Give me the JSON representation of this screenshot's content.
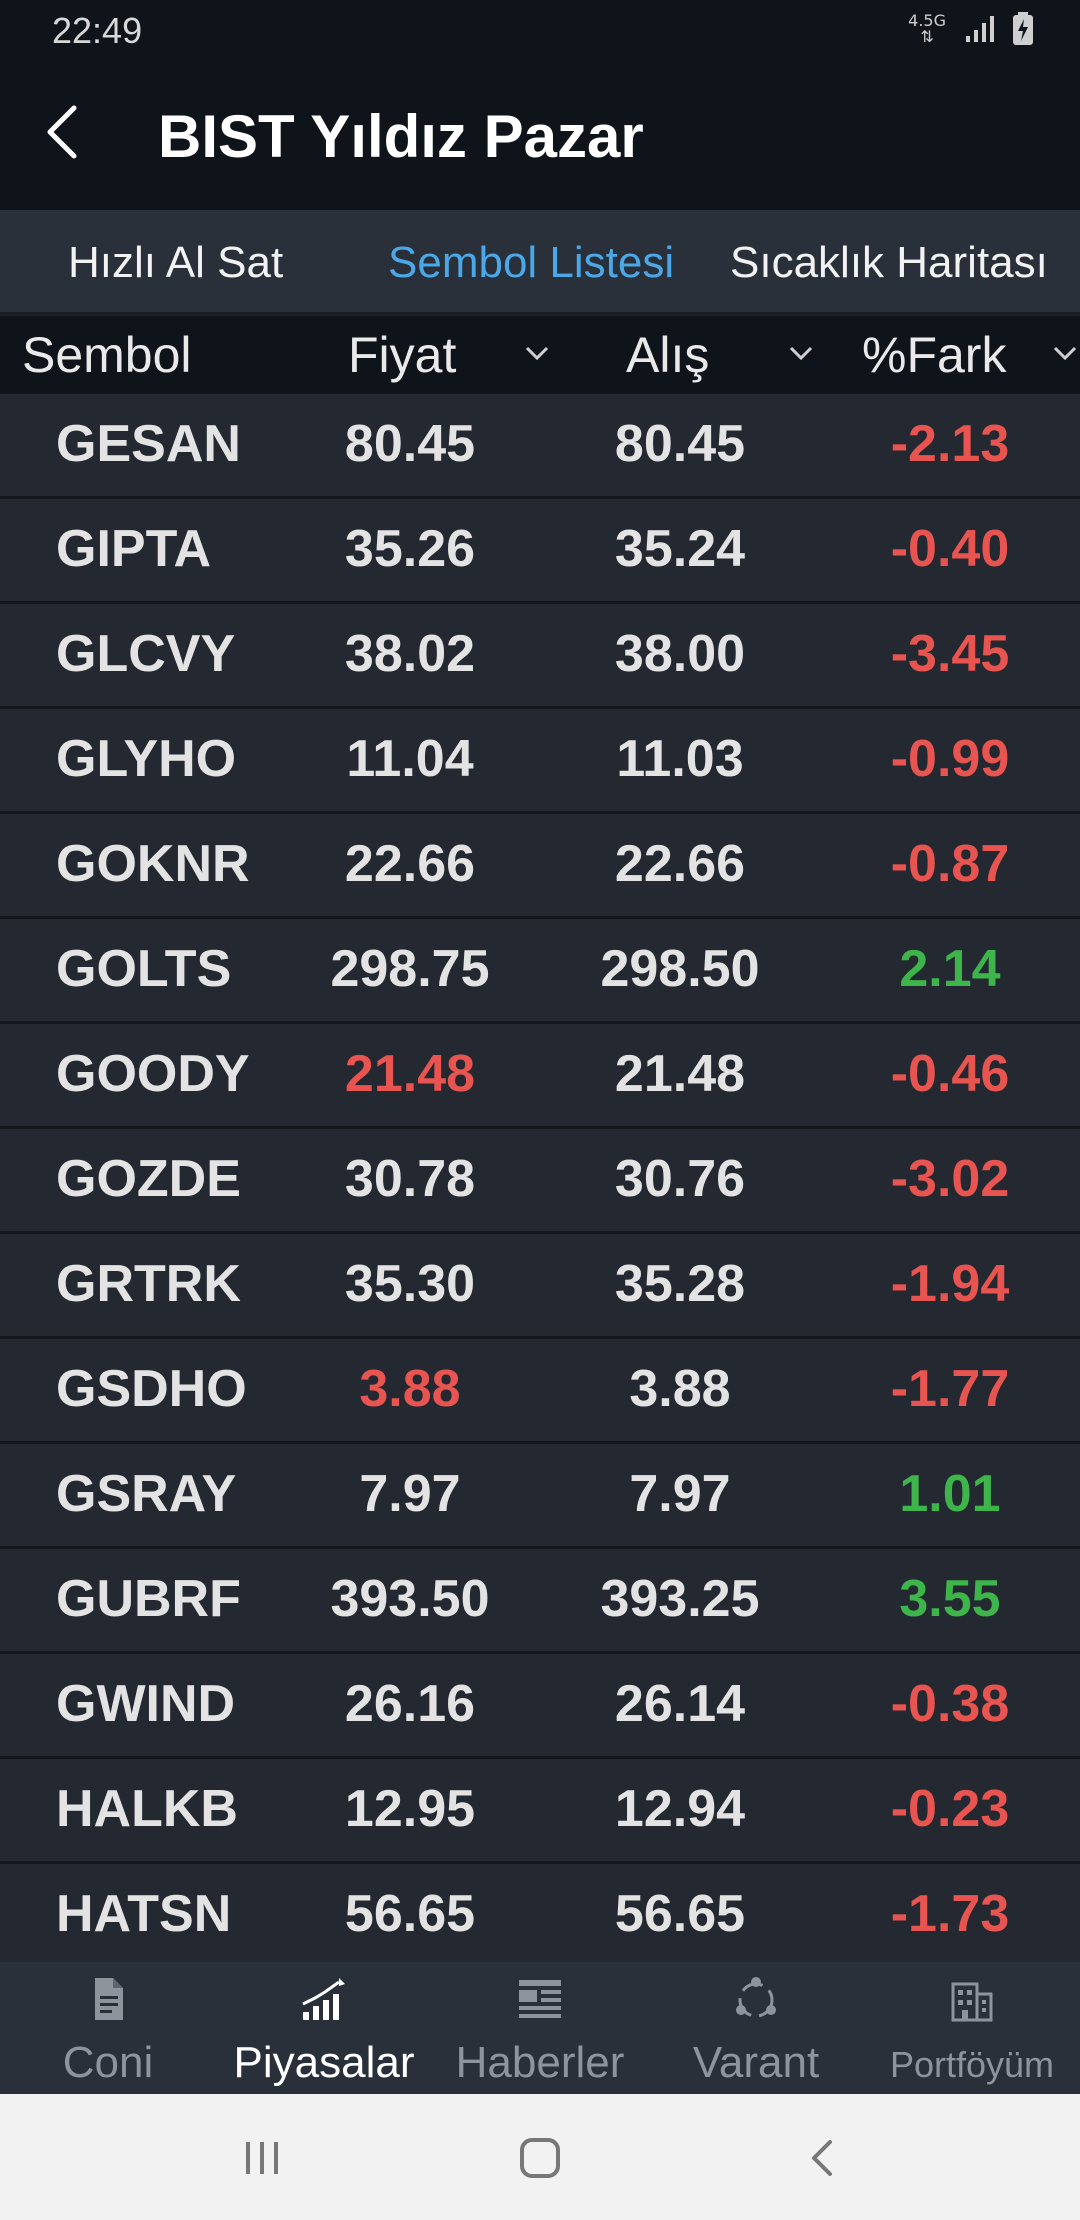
{
  "status": {
    "time": "22:49",
    "network": "4.5G"
  },
  "header": {
    "title": "BIST Yıldız Pazar"
  },
  "tabs": [
    {
      "label": "Hızlı Al Sat",
      "active": false
    },
    {
      "label": "Sembol Listesi",
      "active": true
    },
    {
      "label": "Sıcaklık Haritası",
      "active": false
    }
  ],
  "columns": {
    "symbol": "Sembol",
    "price": "Fiyat",
    "bid": "Alış",
    "change": "%Fark"
  },
  "rows": [
    {
      "symbol": "GESAN",
      "price": "80.45",
      "bid": "80.45",
      "change": "-2.13",
      "price_color": "",
      "change_color": "neg"
    },
    {
      "symbol": "GIPTA",
      "price": "35.26",
      "bid": "35.24",
      "change": "-0.40",
      "price_color": "",
      "change_color": "neg"
    },
    {
      "symbol": "GLCVY",
      "price": "38.02",
      "bid": "38.00",
      "change": "-3.45",
      "price_color": "",
      "change_color": "neg"
    },
    {
      "symbol": "GLYHO",
      "price": "11.04",
      "bid": "11.03",
      "change": "-0.99",
      "price_color": "",
      "change_color": "neg"
    },
    {
      "symbol": "GOKNR",
      "price": "22.66",
      "bid": "22.66",
      "change": "-0.87",
      "price_color": "",
      "change_color": "neg"
    },
    {
      "symbol": "GOLTS",
      "price": "298.75",
      "bid": "298.50",
      "change": "2.14",
      "price_color": "",
      "change_color": "pos"
    },
    {
      "symbol": "GOODY",
      "price": "21.48",
      "bid": "21.48",
      "change": "-0.46",
      "price_color": "neg",
      "change_color": "neg"
    },
    {
      "symbol": "GOZDE",
      "price": "30.78",
      "bid": "30.76",
      "change": "-3.02",
      "price_color": "",
      "change_color": "neg"
    },
    {
      "symbol": "GRTRK",
      "price": "35.30",
      "bid": "35.28",
      "change": "-1.94",
      "price_color": "",
      "change_color": "neg"
    },
    {
      "symbol": "GSDHO",
      "price": "3.88",
      "bid": "3.88",
      "change": "-1.77",
      "price_color": "neg",
      "change_color": "neg"
    },
    {
      "symbol": "GSRAY",
      "price": "7.97",
      "bid": "7.97",
      "change": "1.01",
      "price_color": "",
      "change_color": "pos"
    },
    {
      "symbol": "GUBRF",
      "price": "393.50",
      "bid": "393.25",
      "change": "3.55",
      "price_color": "",
      "change_color": "pos"
    },
    {
      "symbol": "GWIND",
      "price": "26.16",
      "bid": "26.14",
      "change": "-0.38",
      "price_color": "",
      "change_color": "neg"
    },
    {
      "symbol": "HALKB",
      "price": "12.95",
      "bid": "12.94",
      "change": "-0.23",
      "price_color": "",
      "change_color": "neg"
    },
    {
      "symbol": "HATSN",
      "price": "56.65",
      "bid": "56.65",
      "change": "-1.73",
      "price_color": "",
      "change_color": "neg"
    }
  ],
  "bottom_nav": [
    {
      "label": "Coni",
      "icon": "document-icon",
      "active": false
    },
    {
      "label": "Piyasalar",
      "icon": "market-chart-icon",
      "active": true
    },
    {
      "label": "Haberler",
      "icon": "news-icon",
      "active": false
    },
    {
      "label": "Varant",
      "icon": "warrant-icon",
      "active": false
    },
    {
      "label": "Portföyüm",
      "icon": "portfolio-building-icon",
      "active": false
    }
  ],
  "colors": {
    "negative": "#e85450",
    "positive": "#3db54a",
    "accent": "#4aa8e8"
  }
}
